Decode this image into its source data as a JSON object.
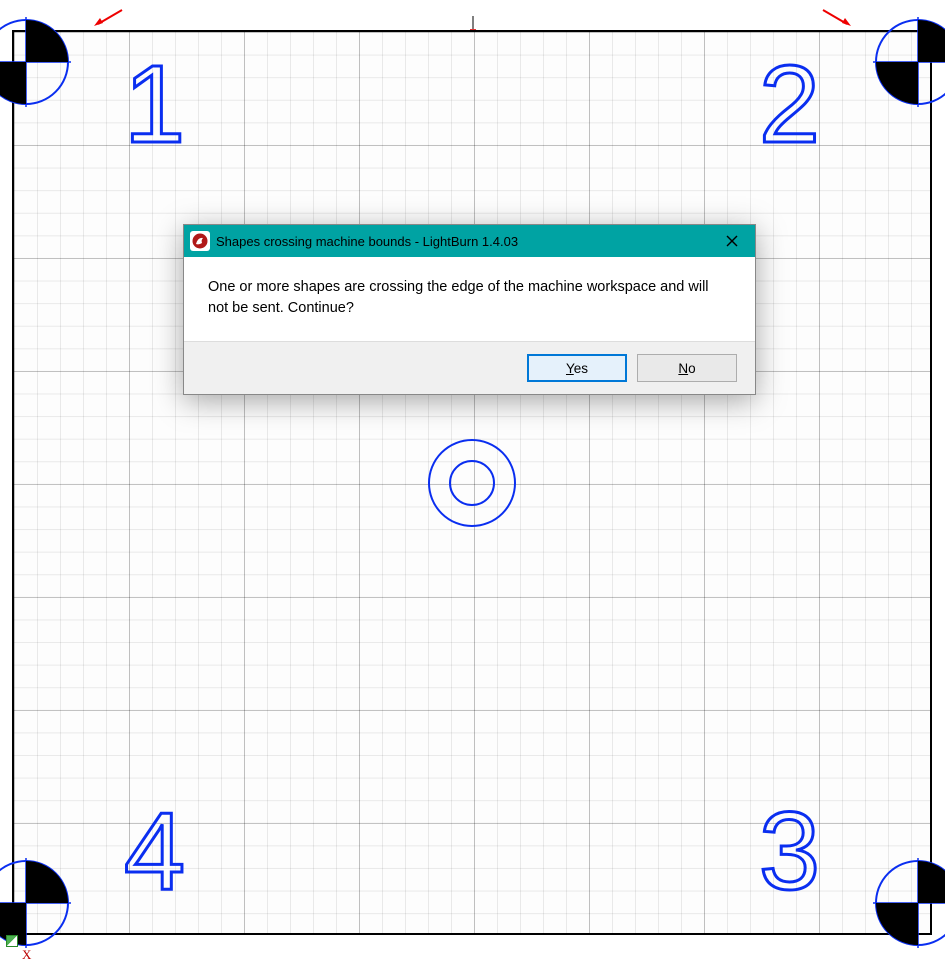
{
  "workspace": {
    "corner_labels": [
      "1",
      "2",
      "3",
      "4"
    ],
    "axis_x_label": "X"
  },
  "dialog": {
    "title": "Shapes crossing machine bounds - LightBurn 1.4.03",
    "message": "One or more shapes are crossing the edge of the machine workspace and will not be sent. Continue?",
    "yes_label": "Yes",
    "no_label": "No"
  }
}
